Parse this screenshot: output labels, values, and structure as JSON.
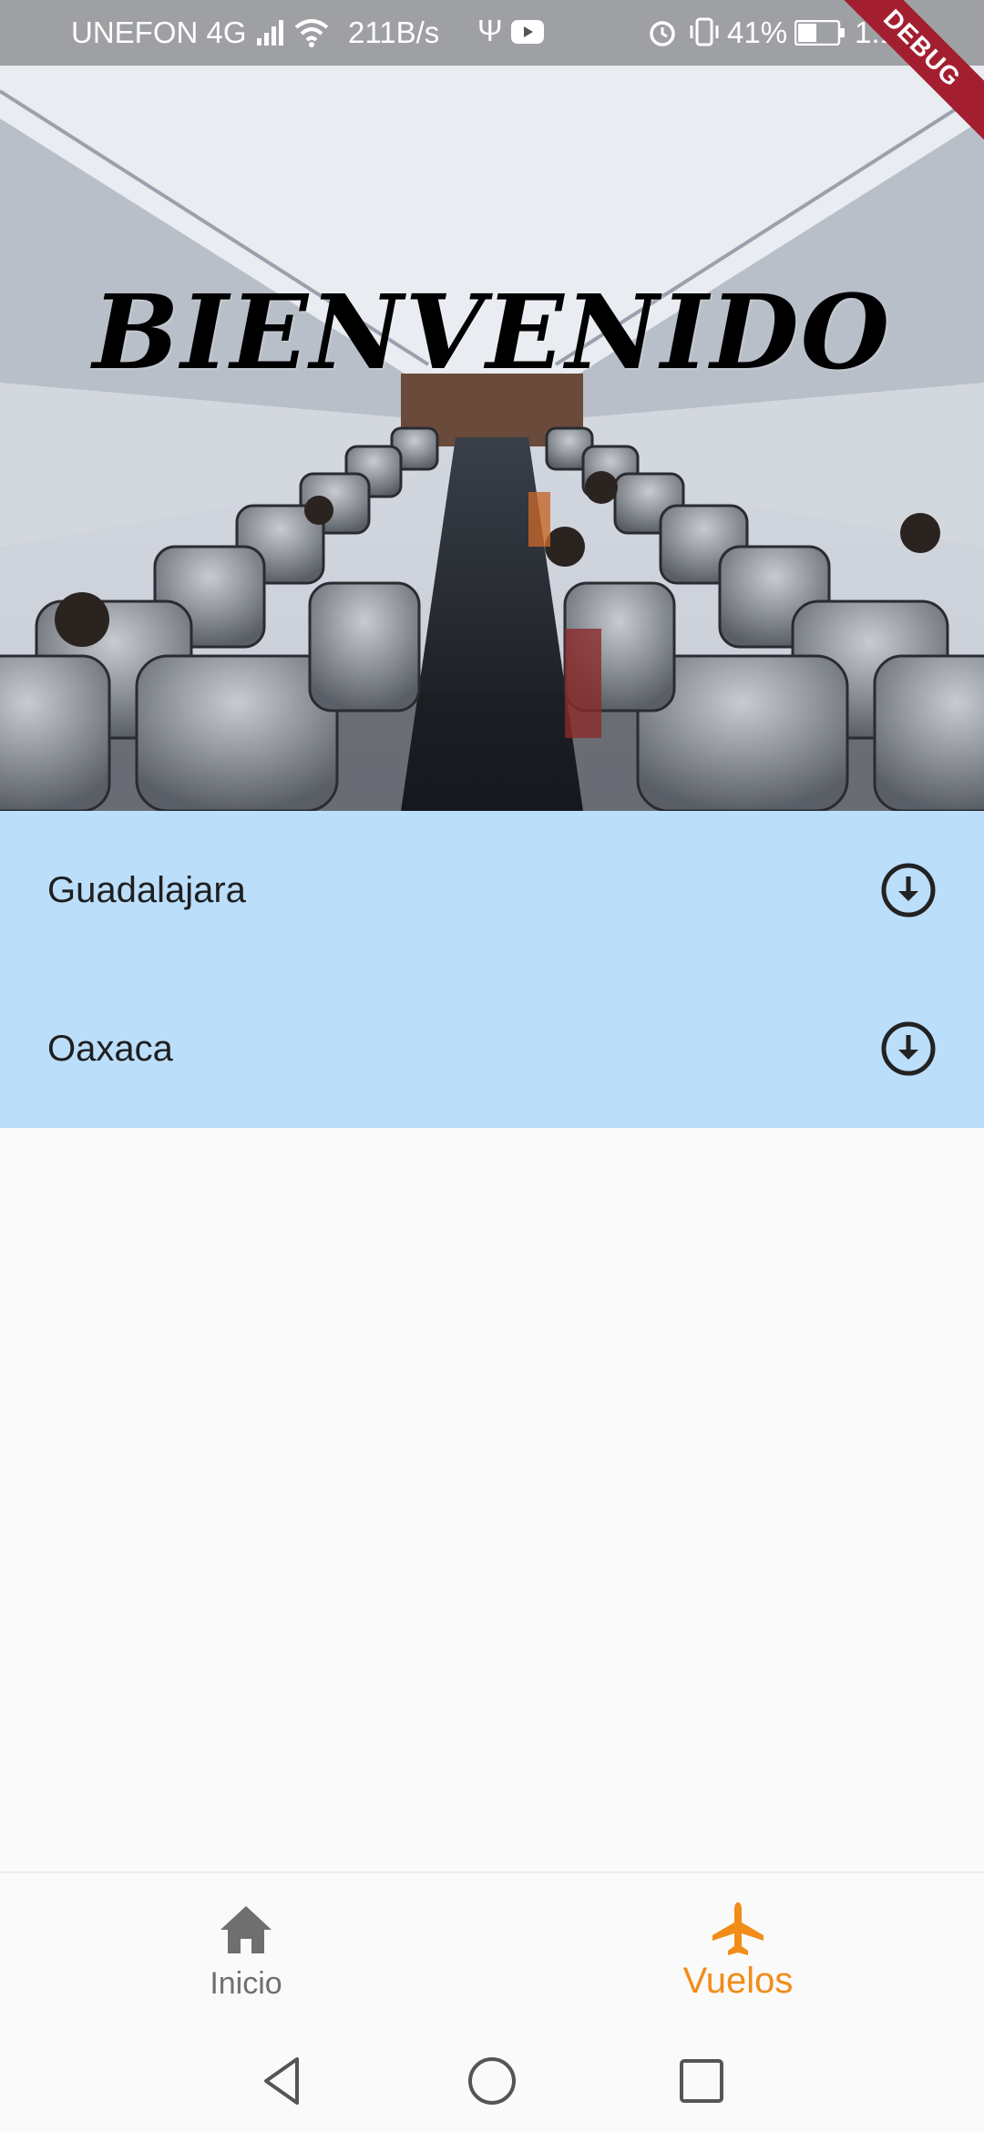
{
  "status_bar": {
    "carrier": "UNEFON 4G",
    "net_speed": "211B/s",
    "battery_percent": "41%",
    "time": "1:15",
    "debug_label": "DEBUG",
    "icons": [
      "signal-icon",
      "wifi-icon",
      "usb-icon",
      "youtube-icon",
      "alarm-icon",
      "vibrate-icon",
      "battery-icon"
    ]
  },
  "hero": {
    "title": "BIENVENIDO",
    "image": "airplane-cabin-photo"
  },
  "destinations": [
    {
      "label": "Guadalajara",
      "icon": "download-circle-icon"
    },
    {
      "label": "Oaxaca",
      "icon": "download-circle-icon"
    }
  ],
  "colors": {
    "list_bg": "#bbdefb",
    "accent": "#f28c18",
    "inactive": "#6f6f6f",
    "debug": "#a31f30"
  },
  "bottom_nav": {
    "items": [
      {
        "label": "Inicio",
        "icon": "home-icon",
        "active": false
      },
      {
        "label": "Vuelos",
        "icon": "airplane-icon",
        "active": true
      }
    ]
  },
  "system_nav": {
    "buttons": [
      "back-icon",
      "home-circle-icon",
      "recents-icon"
    ]
  }
}
